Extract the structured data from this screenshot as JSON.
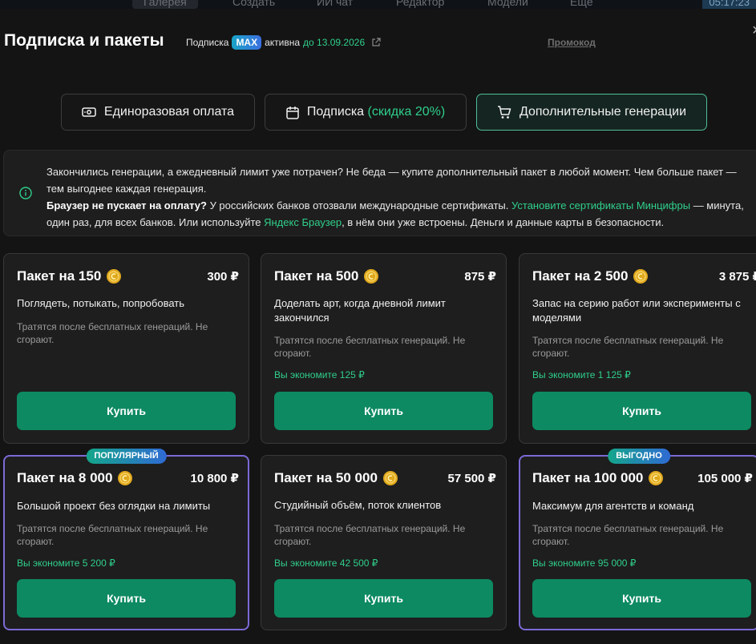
{
  "bg_nav": {
    "items": [
      "Галерея",
      "Создать",
      "ИИ чат",
      "Редактор",
      "Модели",
      "Ещё"
    ],
    "time": "05:17:23"
  },
  "header": {
    "title": "Подписка и пакеты",
    "subscription_label": "Подписка",
    "plan_badge": "MAX",
    "status": "активна",
    "until": "до 13.09.2026",
    "promo_link": "Промокод",
    "close_symbol": "×"
  },
  "tabs": [
    {
      "label": "Единоразовая оплата",
      "icon": "cash-icon"
    },
    {
      "label": "Подписка",
      "accent": "(скидка 20%)",
      "icon": "calendar-icon"
    },
    {
      "label": "Дополнительные генерации",
      "icon": "cart-icon",
      "active": true
    }
  ],
  "info": {
    "line1": "Закончились генерации, а ежедневный лимит уже потрачен? Не беда — купите дополнительный пакет в любой момент. Чем больше пакет — тем выгоднее каждая генерация.",
    "bold": "Браузер не пускает на оплату?",
    "line2a": " У российских банков отозвали международные сертификаты. ",
    "link1": "Установите сертификаты Минцифры",
    "line2b": " — минута, один раз, для всех банков. Или используйте ",
    "link2": "Яндекс Браузер",
    "line2c": ", в нём они уже встроены. Деньги и данные карты в безопасности."
  },
  "packages": [
    {
      "name": "Пакет на 150",
      "price": "300 ₽",
      "desc": "Поглядеть, потыкать, попробовать",
      "note": "Тратятся после бесплатных генераций. Не сгорают.",
      "save": "",
      "badge": "",
      "buy": "Купить"
    },
    {
      "name": "Пакет на 500",
      "price": "875 ₽",
      "desc": "Доделать арт, когда дневной лимит закончился",
      "note": "Тратятся после бесплатных генераций. Не сгорают.",
      "save": "Вы экономите 125 ₽",
      "badge": "",
      "buy": "Купить"
    },
    {
      "name": "Пакет на 2 500",
      "price": "3 875 ₽",
      "desc": "Запас на серию работ или эксперименты с моделями",
      "note": "Тратятся после бесплатных генераций. Не сгорают.",
      "save": "Вы экономите 1 125 ₽",
      "badge": "",
      "buy": "Купить"
    },
    {
      "name": "Пакет на 8 000",
      "price": "10 800 ₽",
      "desc": "Большой проект без оглядки на лимиты",
      "note": "Тратятся после бесплатных генераций. Не сгорают.",
      "save": "Вы экономите 5 200 ₽",
      "badge": "ПОПУЛЯРНЫЙ",
      "buy": "Купить"
    },
    {
      "name": "Пакет на 50 000",
      "price": "57 500 ₽",
      "desc": "Студийный объём, поток клиентов",
      "note": "Тратятся после бесплатных генераций. Не сгорают.",
      "save": "Вы экономите 42 500 ₽",
      "badge": "",
      "buy": "Купить"
    },
    {
      "name": "Пакет на 100 000",
      "price": "105 000 ₽",
      "desc": "Максимум для агентств и команд",
      "note": "Тратятся после бесплатных генераций. Не сгорают.",
      "save": "Вы экономите 95 000 ₽",
      "badge": "ВЫГОДНО",
      "buy": "Купить"
    }
  ],
  "colors": {
    "accent": "#2fcf8b",
    "buy_button": "#0d8a62",
    "featured_border": "#7b6ad6",
    "coin": "#e0a81c"
  }
}
